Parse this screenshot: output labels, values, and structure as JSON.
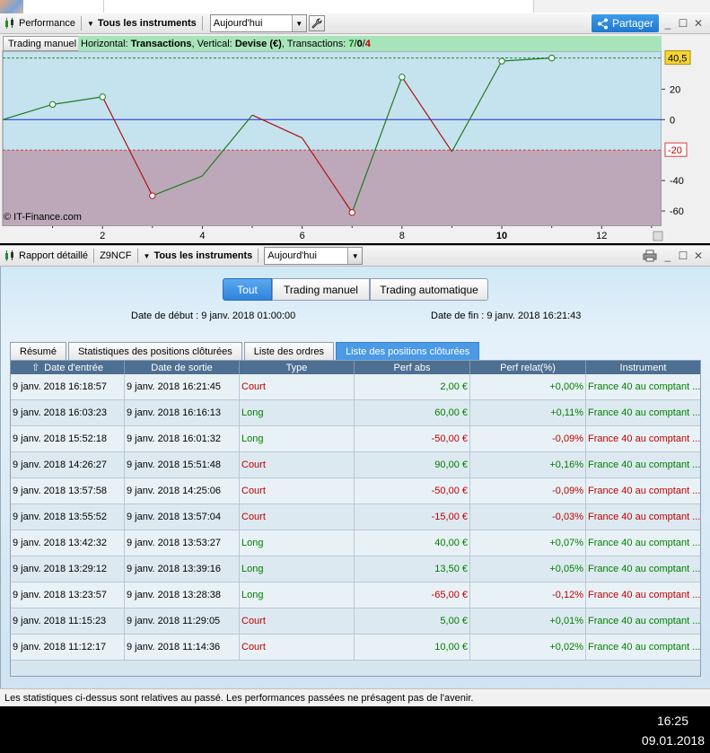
{
  "top_toolbar": {
    "title": "Performance",
    "instruments_label": "Tous les instruments",
    "period_value": "Aujourd'hui",
    "share_label": "Partager"
  },
  "chart": {
    "mode_label": "Trading manuel",
    "info_horizontal_label": "Horizontal:",
    "info_horizontal_value": "Transactions",
    "info_vertical_label": ", Vertical:",
    "info_vertical_value": "Devise (€)",
    "info_trans_label": ", Transactions:",
    "info_trans_win": "7",
    "info_trans_sep1": " / ",
    "info_trans_neutral": "0",
    "info_trans_sep2": " / ",
    "info_trans_loss": "4",
    "copyright": "© IT-Finance.com",
    "last_value_label": "40,5",
    "stop_label": "-20"
  },
  "chart_data": {
    "type": "line",
    "x": [
      0,
      1,
      2,
      3,
      4,
      5,
      6,
      7,
      8,
      9,
      10,
      11
    ],
    "values": [
      0,
      10,
      15,
      -50,
      -37,
      3,
      -12,
      -61,
      28,
      -21,
      38.5,
      40.5
    ],
    "marked_points": [
      1,
      2,
      3,
      7,
      8,
      10,
      11
    ],
    "xticks": [
      "2",
      "4",
      "6",
      "8",
      "10",
      "12"
    ],
    "xtick_values": [
      2,
      4,
      6,
      8,
      10,
      12
    ],
    "highlight_xtick": "10",
    "yticks": [
      "20",
      "0",
      "-40",
      "-60"
    ],
    "ytick_values": [
      20,
      0,
      -40,
      -60
    ],
    "ylim": [
      -70,
      45
    ],
    "xlim": [
      0,
      13.2
    ],
    "zero_line": 0,
    "stop_line": -20,
    "target_line": 40.5,
    "colors": {
      "up": "#1e7d1e",
      "down": "#b01010",
      "zero": "#1a2bd6",
      "bg_pos": "#c4e3ee",
      "bg_neg": "#bda8b9"
    }
  },
  "report_toolbar": {
    "title": "Rapport détaillé",
    "account": "Z9NCF",
    "instruments_label": "Tous les instruments",
    "period_value": "Aujourd'hui"
  },
  "filters": {
    "all": "Tout",
    "manual": "Trading manuel",
    "auto": "Trading automatique"
  },
  "dates": {
    "start": "Date de début :  9 janv. 2018 01:00:00",
    "end": "Date de fin :  9 janv. 2018 16:21:43"
  },
  "tabs": {
    "summary": "Résumé",
    "stats": "Statistiques des positions clôturées",
    "orders": "Liste des ordres",
    "positions": "Liste des positions clôturées"
  },
  "table": {
    "headers": {
      "entry": "Date d'entrée",
      "exit": "Date de sortie",
      "type": "Type",
      "perf_abs": "Perf abs",
      "perf_rel": "Perf relat(%)",
      "instrument": "Instrument"
    },
    "rows": [
      {
        "entry": "9 janv. 2018 16:18:57",
        "exit": "9 janv. 2018 16:21:45",
        "type": "Court",
        "abs": "2,00 €",
        "rel": "+0,00%",
        "inst": "France 40 au comptant ..."
      },
      {
        "entry": "9 janv. 2018 16:03:23",
        "exit": "9 janv. 2018 16:16:13",
        "type": "Long",
        "abs": "60,00 €",
        "rel": "+0,11%",
        "inst": "France 40 au comptant ..."
      },
      {
        "entry": "9 janv. 2018 15:52:18",
        "exit": "9 janv. 2018 16:01:32",
        "type": "Long",
        "abs": "-50,00 €",
        "rel": "-0,09%",
        "inst": "France 40 au comptant ..."
      },
      {
        "entry": "9 janv. 2018 14:26:27",
        "exit": "9 janv. 2018 15:51:48",
        "type": "Court",
        "abs": "90,00 €",
        "rel": "+0,16%",
        "inst": "France 40 au comptant ..."
      },
      {
        "entry": "9 janv. 2018 13:57:58",
        "exit": "9 janv. 2018 14:25:06",
        "type": "Court",
        "abs": "-50,00 €",
        "rel": "-0,09%",
        "inst": "France 40 au comptant ..."
      },
      {
        "entry": "9 janv. 2018 13:55:52",
        "exit": "9 janv. 2018 13:57:04",
        "type": "Court",
        "abs": "-15,00 €",
        "rel": "-0,03%",
        "inst": "France 40 au comptant ..."
      },
      {
        "entry": "9 janv. 2018 13:42:32",
        "exit": "9 janv. 2018 13:53:27",
        "type": "Long",
        "abs": "40,00 €",
        "rel": "+0,07%",
        "inst": "France 40 au comptant ..."
      },
      {
        "entry": "9 janv. 2018 13:29:12",
        "exit": "9 janv. 2018 13:39:16",
        "type": "Long",
        "abs": "13,50 €",
        "rel": "+0,05%",
        "inst": "France 40 au comptant ..."
      },
      {
        "entry": "9 janv. 2018 13:23:57",
        "exit": "9 janv. 2018 13:28:38",
        "type": "Long",
        "abs": "-65,00 €",
        "rel": "-0,12%",
        "inst": "France 40 au comptant ..."
      },
      {
        "entry": "9 janv. 2018 11:15:23",
        "exit": "9 janv. 2018 11:29:05",
        "type": "Court",
        "abs": "5,00 €",
        "rel": "+0,01%",
        "inst": "France 40 au comptant ..."
      },
      {
        "entry": "9 janv. 2018 11:12:17",
        "exit": "9 janv. 2018 11:14:36",
        "type": "Court",
        "abs": "10,00 €",
        "rel": "+0,02%",
        "inst": "France 40 au comptant ..."
      }
    ]
  },
  "footer": {
    "disclaimer": "Les statistiques ci-dessus sont relatives au passé. Les performances passées ne présagent pas de l'avenir."
  },
  "taskbar": {
    "time": "16:25",
    "date": "09.01.2018"
  }
}
